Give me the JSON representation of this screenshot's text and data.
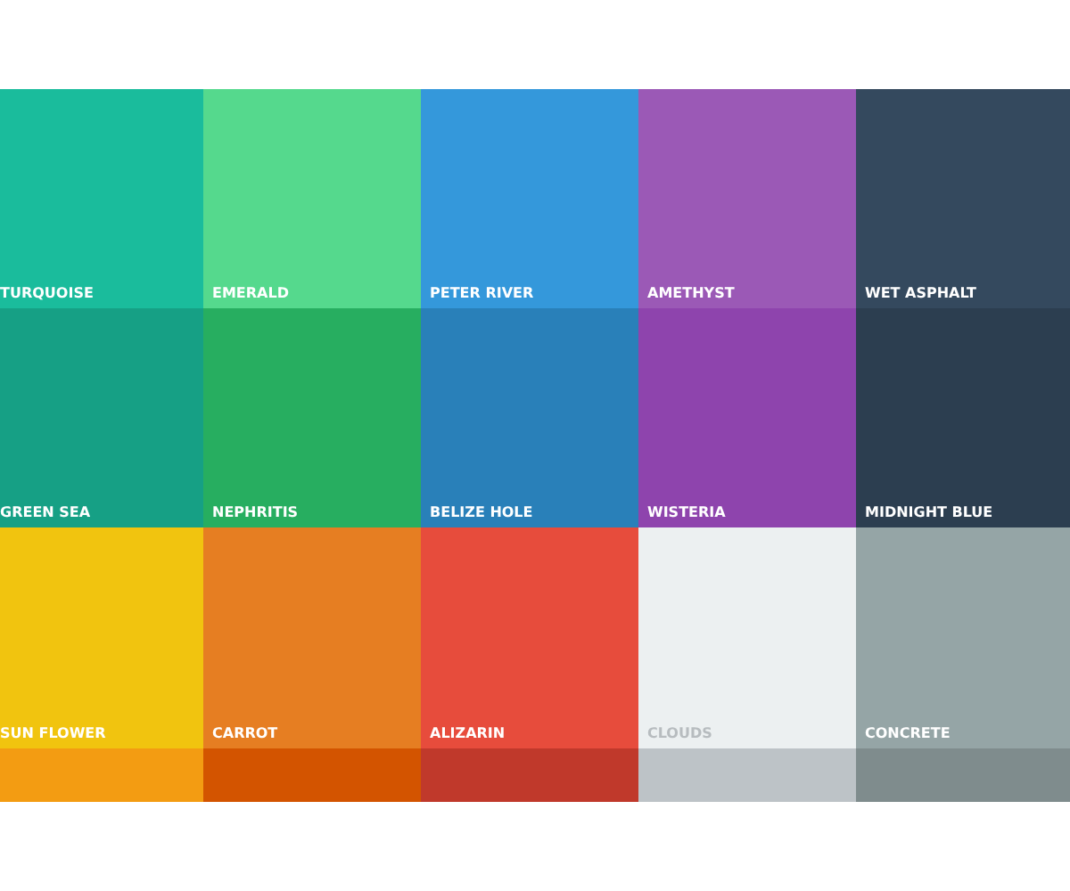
{
  "palette": {
    "rows": [
      {
        "swatches": [
          {
            "name": "TURQUOISE",
            "color": "#1abc9c"
          },
          {
            "name": "EMERALD",
            "color": "#55d98d"
          },
          {
            "name": "PETER RIVER",
            "color": "#3498db"
          },
          {
            "name": "AMETHYST",
            "color": "#9b59b6"
          },
          {
            "name": "WET ASPHALT",
            "color": "#34495e"
          }
        ]
      },
      {
        "swatches": [
          {
            "name": "GREEN SEA",
            "color": "#16a085"
          },
          {
            "name": "NEPHRITIS",
            "color": "#27ae60"
          },
          {
            "name": "BELIZE HOLE",
            "color": "#2980b9"
          },
          {
            "name": "WISTERIA",
            "color": "#8e44ad"
          },
          {
            "name": "MIDNIGHT BLUE",
            "color": "#2c3e50"
          }
        ]
      },
      {
        "swatches": [
          {
            "name": "SUN FLOWER",
            "color": "#f1c40f"
          },
          {
            "name": "CARROT",
            "color": "#e67e22"
          },
          {
            "name": "ALIZARIN",
            "color": "#e74c3c"
          },
          {
            "name": "CLOUDS",
            "color": "#ecf0f1"
          },
          {
            "name": "CONCRETE",
            "color": "#95a5a6"
          }
        ]
      },
      {
        "swatches": [
          {
            "color": "#f39c12"
          },
          {
            "color": "#d35400"
          },
          {
            "color": "#c0392b"
          },
          {
            "color": "#bdc3c7"
          },
          {
            "color": "#7f8c8d"
          }
        ]
      }
    ]
  }
}
